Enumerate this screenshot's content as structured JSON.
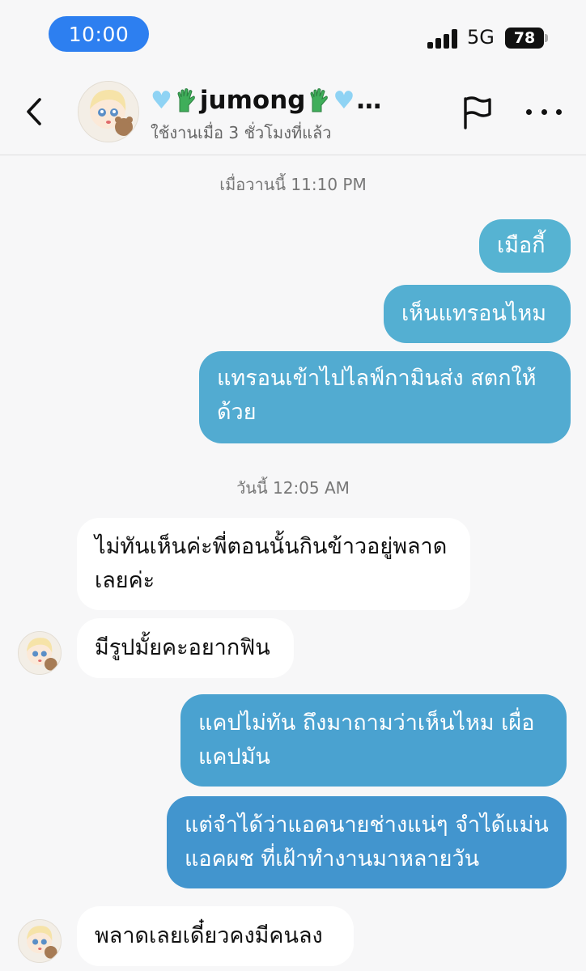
{
  "status_bar": {
    "time": "10:00",
    "network": "5G",
    "battery": "78"
  },
  "header": {
    "name_text": "jumong",
    "name_suffix": "…",
    "last_seen": "ใช้งานเมื่อ 3 ชั่วโมงที่แล้ว",
    "icons": [
      "back-chevron-icon",
      "blue-heart-icon",
      "green-glove-icon",
      "flag-icon",
      "more-icon"
    ]
  },
  "chat": {
    "date_1": "เมื่อวานนี้ 11:10 PM",
    "msg_1": "เมือกี้",
    "msg_2": "เห็นแทรอนไหม",
    "msg_3_line1": "แทรอนเข้าไปไลฟ์กามินส่ง สตกให้",
    "msg_3_line2": "ด้วย",
    "date_2": "วันนี้ 12:05 AM",
    "msg_4_line1": "ไม่ทันเห็นค่ะพี่ตอนนั้นกินข้าวอยู่พลาด",
    "msg_4_line2": "เลยค่ะ",
    "msg_5": "มีรูปมั้ยคะอยากฟิน",
    "msg_6_line1": "แคปไม่ทัน ถึงมาถามว่าเห็นไหม เผื่อ",
    "msg_6_line2": "แคปมัน",
    "msg_7_line1": "แต่จำได้ว่าแอคนายช่างแน่ๆ จำได้แม่น",
    "msg_7_line2": "แอคผช ที่เฝ้าทำงานมาหลายวัน",
    "msg_8": "พลาดเลยเดี๋ยวคงมีคนลง"
  },
  "colors": {
    "outgoing_top": "#58b9d1",
    "outgoing_bottom": "#3f8fcf",
    "incoming": "#ffffff",
    "time_pill": "#2d7ff0"
  }
}
